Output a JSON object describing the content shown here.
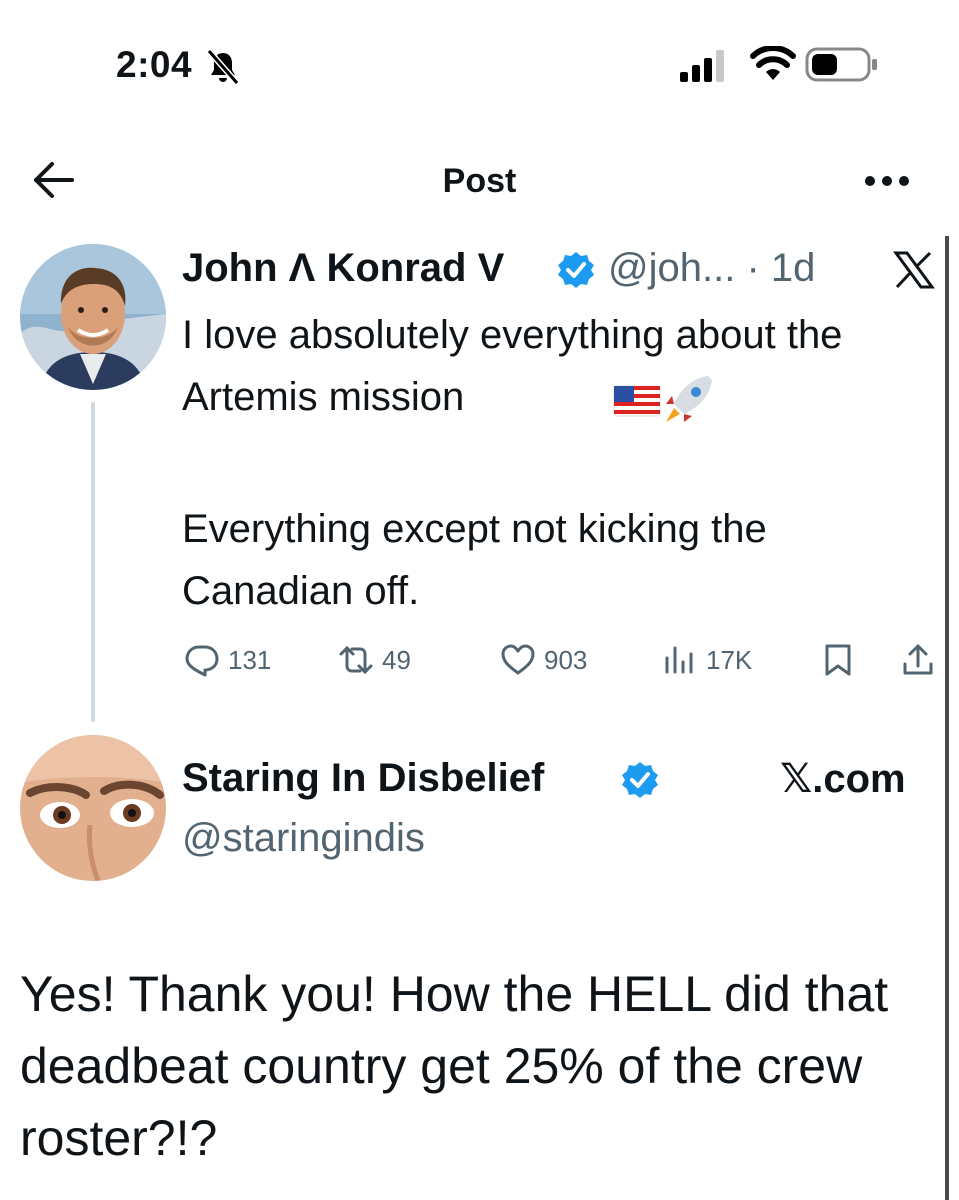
{
  "status_bar": {
    "time": "2:04"
  },
  "header": {
    "title": "Post"
  },
  "tweet": {
    "author_name": "John Λ Konrad V",
    "handle_time": "@joh... · 1d",
    "text_line1": "I love absolutely everything about the Artemis mission",
    "text_line2": "Everything except not kicking the Canadian off.",
    "stats": {
      "replies": "131",
      "reposts": "49",
      "likes": "903",
      "views": "17K"
    }
  },
  "quoted_reply": {
    "author_name": "Staring In Disbelief",
    "handle": "@staringindis",
    "badge_site": "𝕏.com",
    "text": "Yes! Thank you! How the HELL did that deadbeat country get 25% of the crew roster?!?"
  },
  "colors": {
    "verified": "#1d9bf0",
    "muted": "#536471",
    "thread_line": "#cfd9de"
  },
  "icons": [
    "bell-muted-icon",
    "signal-icon",
    "wifi-icon",
    "battery-icon",
    "back-arrow-icon",
    "more-icon",
    "verified-icon",
    "x-logo-icon",
    "reply-icon",
    "repost-icon",
    "like-icon",
    "views-icon",
    "bookmark-icon",
    "share-icon",
    "us-flag-emoji",
    "rocket-emoji"
  ]
}
